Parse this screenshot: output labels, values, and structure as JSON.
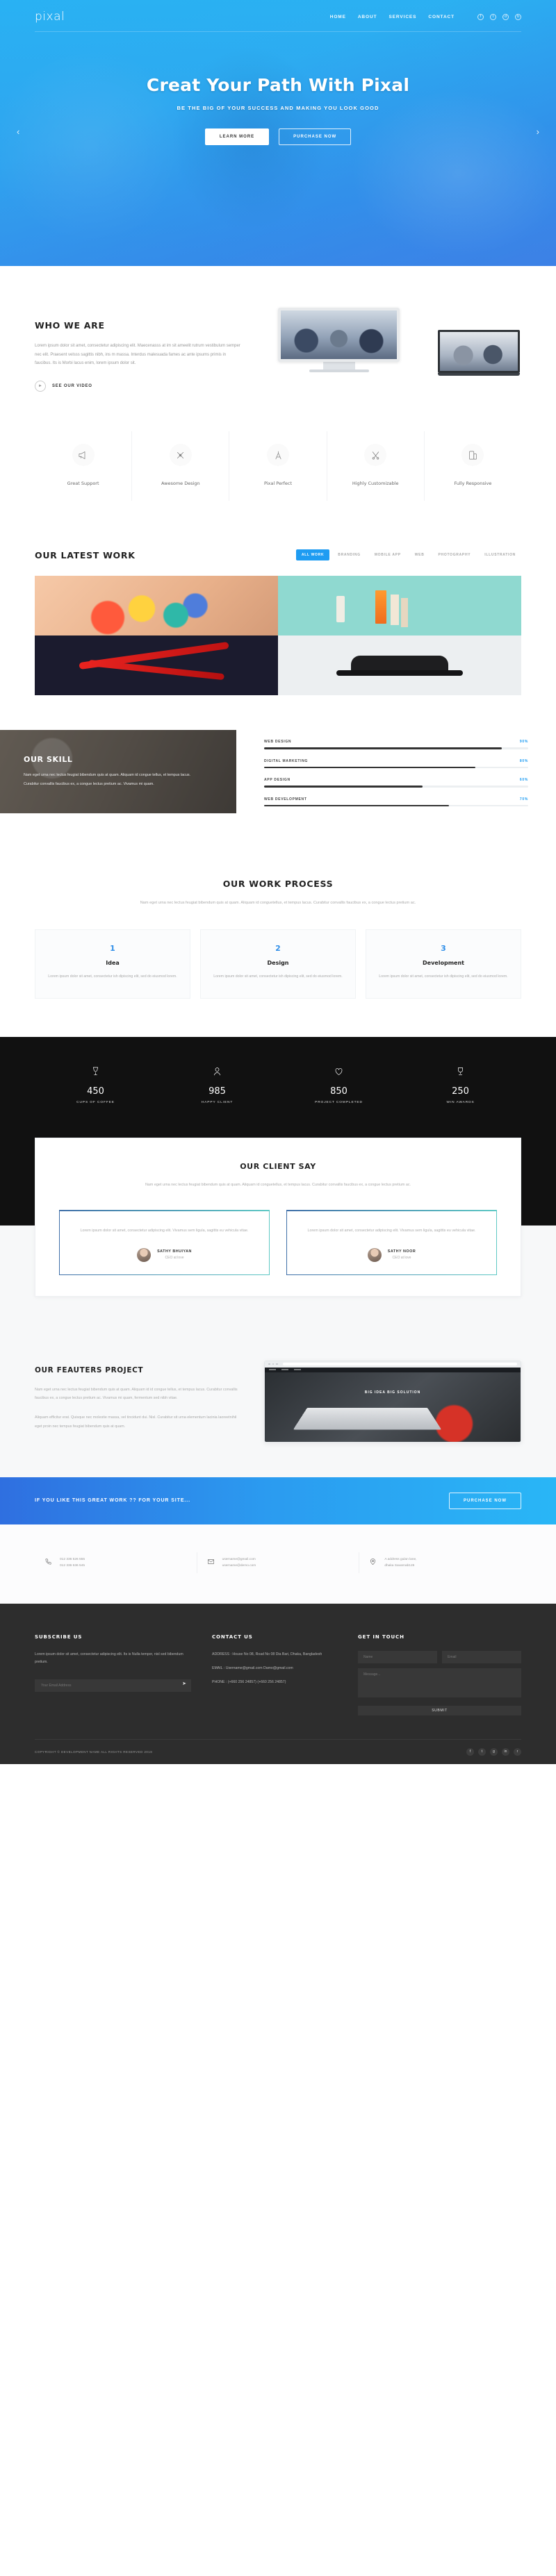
{
  "header": {
    "logo": "pixal",
    "nav": [
      {
        "label": "HOME"
      },
      {
        "label": "ABOUT"
      },
      {
        "label": "SERVICES"
      },
      {
        "label": "CONTACT"
      }
    ],
    "socials": [
      {
        "name": "facebook-icon",
        "glyph": "f"
      },
      {
        "name": "twitter-icon",
        "glyph": "t"
      },
      {
        "name": "dribbble-icon",
        "glyph": "d"
      },
      {
        "name": "behance-icon",
        "glyph": "b"
      }
    ]
  },
  "hero": {
    "title": "Creat Your Path With Pixal",
    "subtitle": "BE THE BIG OF YOUR SUCCESS AND MAKING YOU LOOK GOOD",
    "btn_primary": "LEARN MORE",
    "btn_secondary": "PURCHASE NOW",
    "arrow_left": "‹",
    "arrow_right": "›"
  },
  "who": {
    "title": "WHO WE ARE",
    "body": "Lorem ipsum dolor sit amet, consectetur adipiscing elit. Maecenasss at im sit ameelit rutrum vestibulum semper nec elit. Praesent velsss sagittis nibh, ins m massa. Interdus malesuada fames ac ante ipsums primis in faucibus. Its is Morbi lacus enim, lorem ipsum dolor sit.",
    "video_label": "SEE OUR VIDEO"
  },
  "features": [
    {
      "label": "Great Support",
      "icon": "megaphone-icon"
    },
    {
      "label": "Awesome Design",
      "icon": "pen-cross-icon"
    },
    {
      "label": "Pixal Perfect",
      "icon": "compass-icon"
    },
    {
      "label": "Highly Customizable",
      "icon": "tools-icon"
    },
    {
      "label": "Fully Responsive",
      "icon": "devices-icon"
    }
  ],
  "work": {
    "title": "OUR LATEST WORK",
    "filters": [
      {
        "label": "ALL WORK",
        "active": true
      },
      {
        "label": "BRANDING",
        "active": false
      },
      {
        "label": "MOBILE APP",
        "active": false
      },
      {
        "label": "WEB",
        "active": false
      },
      {
        "label": "PHOTOGRAPHY",
        "active": false
      },
      {
        "label": "ILLUSTRATION",
        "active": false
      }
    ],
    "items": [
      {
        "name": "colorful-hands-artwork"
      },
      {
        "name": "desk-supplies-artwork"
      },
      {
        "name": "red-chili-artwork"
      },
      {
        "name": "black-cap-artwork"
      }
    ]
  },
  "skill": {
    "title": "OUR SKILL",
    "body": "Nam eget urna nec lectus feugiat bibendum quis at quam. Aliquam id congue tellus, et tempus lacus. Curabitur convallis faucibus ex, a congue lectus pretium ac. Vivamus mi quam.",
    "bars": [
      {
        "label": "WEB DESIGN",
        "pct": "90%",
        "value": 90
      },
      {
        "label": "DIGITAL MARKETING",
        "pct": "80%",
        "value": 80
      },
      {
        "label": "APP DESIGN",
        "pct": "60%",
        "value": 60
      },
      {
        "label": "WEB DEVELOPMENT",
        "pct": "70%",
        "value": 70
      }
    ]
  },
  "process": {
    "title": "OUR WORK PROCESS",
    "lead": "Nam eget urna nec lectus feugiat bibendum quis at quam. Aliquam id conguetellus, et tempus lacus. Curabitur convallis faucibus ex, a congue lectus pretium ac.",
    "steps": [
      {
        "num": "1",
        "title": "Idea",
        "body": "Lorem ipsum dolor sit amet, consectetur ish dipiscing elit, sed do eiusmod lorem."
      },
      {
        "num": "2",
        "title": "Design",
        "body": "Lorem ipsum dolor sit amet, consectetur ish dipiscing elit, sed do eiusmod lorem."
      },
      {
        "num": "3",
        "title": "Development",
        "body": "Lorem ipsum dolor sit amet, consectetur ish dipiscing elit, sed do eiusmod lorem."
      }
    ]
  },
  "counters": [
    {
      "num": "450",
      "label": "CUPS OF COFFEE",
      "icon": "wine-glass-icon"
    },
    {
      "num": "985",
      "label": "HAPPY CLIENT",
      "icon": "user-icon"
    },
    {
      "num": "850",
      "label": "PROJECT COMPLETED",
      "icon": "heart-icon"
    },
    {
      "num": "250",
      "label": "WIN AWARDS",
      "icon": "trophy-icon"
    }
  ],
  "testimonials": {
    "title": "OUR CLIENT SAY",
    "lead": "Nam eget urna nec lectus feugiat bibendum quis at quam. Aliquam id conguetellus, et tempus lacus. Curabitur convallis faucibus ex, a congue lectus pretium ac.",
    "items": [
      {
        "quote": "Lorem ipsum dolor sit amet, consectetur adipiscing elit. Vivamus sem ligula, sagittis eu vehicula vitae.",
        "name": "SATHY BHUIYAN",
        "role": "CEO at love"
      },
      {
        "quote": "Lorem ipsum dolor sit amet, consectetur adipiscing elit. Vivamus sem ligula, sagittis eu vehicula vitae.",
        "name": "SATHY NOOR",
        "role": "CEO at love"
      }
    ]
  },
  "featured": {
    "title": "OUR FEAUTERS PROJECT",
    "p1": "Nam eget urna nec lectus feugiat bibendum quis at quam. Aliquam id id congue tellus, et tempus lacus. Curabitur convallis faucibus ex, a congue lectus pretium ac. Vivamus mi quam, fermentum sed nibh vitae.",
    "p2": "Aliquam efficitur erat. Quisque nec molestie massa, vel tincidunt dui. Nisl. Curabitur sit urna elementum lacinia laoreetnihil eget proin nec tempus feugiat bibendum quis at quam.",
    "browser_caption": "BIG IDEA BIG SOLUTION"
  },
  "cta": {
    "text": "IF YOU LIKE THIS GREAT WORK ?? FOR YOUR SITE...",
    "button": "PURCHASE NOW"
  },
  "contact_cards": [
    {
      "icon": "phone-icon",
      "lines": [
        "012 336 526 555",
        "012 336 636 545"
      ]
    },
    {
      "icon": "mail-icon",
      "lines": [
        "username@gmail.com",
        "username@demo.com"
      ]
    },
    {
      "icon": "pin-icon",
      "lines": [
        "A address gulan lane,",
        "dhaka Savarnab126"
      ]
    }
  ],
  "footer": {
    "subscribe": {
      "title": "SUBSCRIBE US",
      "body": "Lorem ipsum dolor sit amet, consectetur adipiscing elit. Its is Nulla tempor, nisl sed bibendum pretium.",
      "placeholder": "Your Email Address",
      "send_icon": "➤"
    },
    "contact": {
      "title": "CONTACT US",
      "address": "ADDRESS : House No 08, Road No 08 Dia Bari, Dhaka, Bangladesh",
      "email": "EMAIL : Username@gmail.com Damo@gmail.com",
      "phone": "PHONE : (+660 256 24857) (+660 256 24857)"
    },
    "touch": {
      "title": "GET IN TOUCH",
      "name_placeholder": "Name",
      "email_placeholder": "Email",
      "message_placeholder": "Message...",
      "send_label": "SUBMIT"
    },
    "copyright": "COPYRIGHT © DEVELOPMENT NAME ALL RIGHTS RESERVED 2018",
    "socials": [
      {
        "name": "facebook-icon",
        "glyph": "f"
      },
      {
        "name": "twitter-icon",
        "glyph": "t"
      },
      {
        "name": "google-plus-icon",
        "glyph": "g"
      },
      {
        "name": "linkedin-icon",
        "glyph": "in"
      },
      {
        "name": "rss-icon",
        "glyph": "r"
      }
    ]
  },
  "colors": {
    "accent": "#1e9cf2",
    "hero_from": "#29b4f4",
    "hero_to": "#3f7fe4",
    "dark": "#111111",
    "footer": "#2d2d2d"
  }
}
